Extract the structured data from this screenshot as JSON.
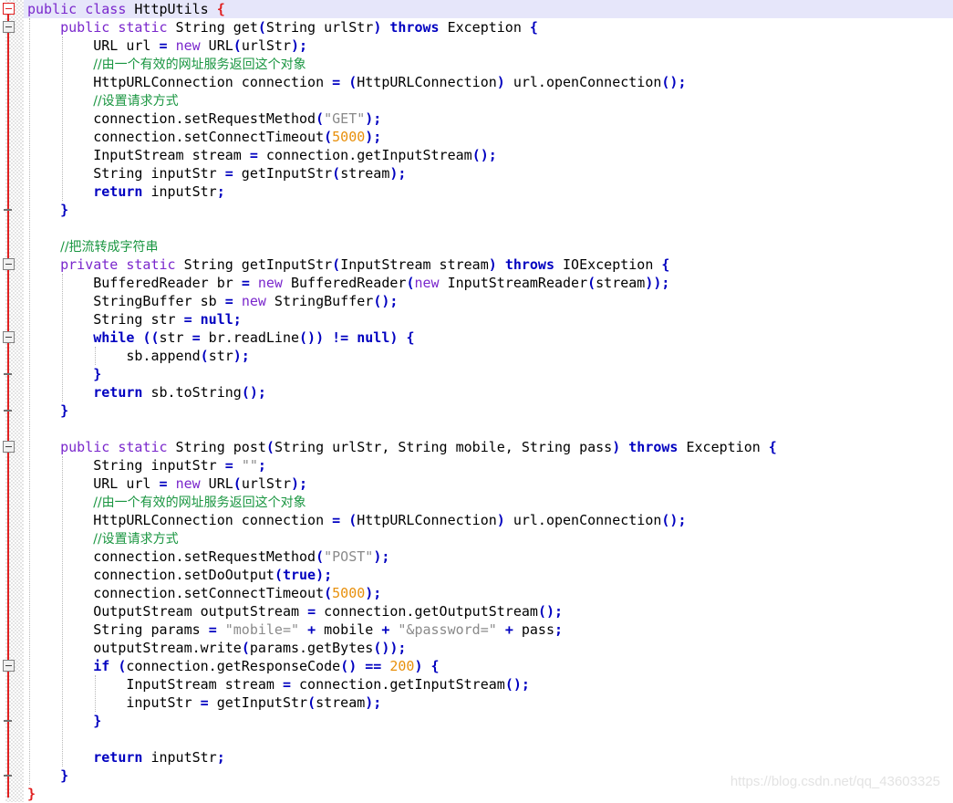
{
  "editor": {
    "language": "java",
    "class_name": "HttpUtils",
    "highlighted_line": 1,
    "colors": {
      "background": "#ffffff",
      "keyword": "#7a27cc",
      "keyword_bold": "#0000c0",
      "comment": "#1a9641",
      "string": "#8a8a8a",
      "number": "#e8900c",
      "punctuation": "#0000c0",
      "class_brace": "#e02020",
      "fold_line": "#e02020",
      "highlight_row": "#e6e6fa",
      "indent_guide": "#b8b8b8",
      "watermark": "#e3e3e3"
    }
  },
  "watermark": {
    "text": "https://blog.csdn.net/qq_43603325"
  },
  "gutter": {
    "fold_boxes_label": "collapse-block",
    "fold_tick_label": "block-end-marker"
  },
  "code_lines": [
    {
      "n": 1,
      "indent": 0,
      "highlight": true,
      "tokens": [
        {
          "t": "public",
          "c": "kw"
        },
        {
          "t": " ",
          "c": "id"
        },
        {
          "t": "class",
          "c": "kw"
        },
        {
          "t": " ",
          "c": "id"
        },
        {
          "t": "HttpUtils",
          "c": "id"
        },
        {
          "t": " ",
          "c": "id"
        },
        {
          "t": "{",
          "c": "brc"
        }
      ]
    },
    {
      "n": 2,
      "indent": 1,
      "tokens": [
        {
          "t": "public",
          "c": "kw"
        },
        {
          "t": " ",
          "c": "id"
        },
        {
          "t": "static",
          "c": "kw"
        },
        {
          "t": " String get",
          "c": "id"
        },
        {
          "t": "(",
          "c": "pun"
        },
        {
          "t": "String urlStr",
          "c": "id"
        },
        {
          "t": ")",
          "c": "pun"
        },
        {
          "t": " ",
          "c": "id"
        },
        {
          "t": "throws",
          "c": "kwb"
        },
        {
          "t": " Exception ",
          "c": "id"
        },
        {
          "t": "{",
          "c": "pun"
        }
      ]
    },
    {
      "n": 3,
      "indent": 2,
      "tokens": [
        {
          "t": "URL url ",
          "c": "id"
        },
        {
          "t": "=",
          "c": "pun"
        },
        {
          "t": " ",
          "c": "id"
        },
        {
          "t": "new",
          "c": "kw"
        },
        {
          "t": " URL",
          "c": "id"
        },
        {
          "t": "(",
          "c": "pun"
        },
        {
          "t": "urlStr",
          "c": "id"
        },
        {
          "t": ");",
          "c": "pun"
        }
      ]
    },
    {
      "n": 4,
      "indent": 2,
      "tokens": [
        {
          "t": "//由一个有效的网址服务返回这个对象",
          "c": "cmt cn"
        }
      ]
    },
    {
      "n": 5,
      "indent": 2,
      "tokens": [
        {
          "t": "HttpURLConnection connection ",
          "c": "id"
        },
        {
          "t": "=",
          "c": "pun"
        },
        {
          "t": " ",
          "c": "id"
        },
        {
          "t": "(",
          "c": "pun"
        },
        {
          "t": "HttpURLConnection",
          "c": "id"
        },
        {
          "t": ")",
          "c": "pun"
        },
        {
          "t": " url.openConnection",
          "c": "id"
        },
        {
          "t": "();",
          "c": "pun"
        }
      ]
    },
    {
      "n": 6,
      "indent": 2,
      "tokens": [
        {
          "t": "//设置请求方式",
          "c": "cmt cn"
        }
      ]
    },
    {
      "n": 7,
      "indent": 2,
      "tokens": [
        {
          "t": "connection.setRequestMethod",
          "c": "id"
        },
        {
          "t": "(",
          "c": "pun"
        },
        {
          "t": "\"GET\"",
          "c": "str"
        },
        {
          "t": ");",
          "c": "pun"
        }
      ]
    },
    {
      "n": 8,
      "indent": 2,
      "tokens": [
        {
          "t": "connection.setConnectTimeout",
          "c": "id"
        },
        {
          "t": "(",
          "c": "pun"
        },
        {
          "t": "5000",
          "c": "num"
        },
        {
          "t": ");",
          "c": "pun"
        }
      ]
    },
    {
      "n": 9,
      "indent": 2,
      "tokens": [
        {
          "t": "InputStream stream ",
          "c": "id"
        },
        {
          "t": "=",
          "c": "pun"
        },
        {
          "t": " connection.getInputStream",
          "c": "id"
        },
        {
          "t": "();",
          "c": "pun"
        }
      ]
    },
    {
      "n": 10,
      "indent": 2,
      "tokens": [
        {
          "t": "String inputStr ",
          "c": "id"
        },
        {
          "t": "=",
          "c": "pun"
        },
        {
          "t": " getInputStr",
          "c": "id"
        },
        {
          "t": "(",
          "c": "pun"
        },
        {
          "t": "stream",
          "c": "id"
        },
        {
          "t": ");",
          "c": "pun"
        }
      ]
    },
    {
      "n": 11,
      "indent": 2,
      "tokens": [
        {
          "t": "return",
          "c": "kwb"
        },
        {
          "t": " inputStr",
          "c": "id"
        },
        {
          "t": ";",
          "c": "pun"
        }
      ]
    },
    {
      "n": 12,
      "indent": 1,
      "tokens": [
        {
          "t": "}",
          "c": "pun"
        }
      ]
    },
    {
      "n": 13,
      "indent": 0,
      "tokens": []
    },
    {
      "n": 14,
      "indent": 1,
      "tokens": [
        {
          "t": "//把流转成字符串",
          "c": "cmt cn"
        }
      ]
    },
    {
      "n": 15,
      "indent": 1,
      "tokens": [
        {
          "t": "private",
          "c": "kw"
        },
        {
          "t": " ",
          "c": "id"
        },
        {
          "t": "static",
          "c": "kw"
        },
        {
          "t": " String getInputStr",
          "c": "id"
        },
        {
          "t": "(",
          "c": "pun"
        },
        {
          "t": "InputStream stream",
          "c": "id"
        },
        {
          "t": ")",
          "c": "pun"
        },
        {
          "t": " ",
          "c": "id"
        },
        {
          "t": "throws",
          "c": "kwb"
        },
        {
          "t": " IOException ",
          "c": "id"
        },
        {
          "t": "{",
          "c": "pun"
        }
      ]
    },
    {
      "n": 16,
      "indent": 2,
      "tokens": [
        {
          "t": "BufferedReader br ",
          "c": "id"
        },
        {
          "t": "=",
          "c": "pun"
        },
        {
          "t": " ",
          "c": "id"
        },
        {
          "t": "new",
          "c": "kw"
        },
        {
          "t": " BufferedReader",
          "c": "id"
        },
        {
          "t": "(",
          "c": "pun"
        },
        {
          "t": "new",
          "c": "kw"
        },
        {
          "t": " InputStreamReader",
          "c": "id"
        },
        {
          "t": "(",
          "c": "pun"
        },
        {
          "t": "stream",
          "c": "id"
        },
        {
          "t": "));",
          "c": "pun"
        }
      ]
    },
    {
      "n": 17,
      "indent": 2,
      "tokens": [
        {
          "t": "StringBuffer sb ",
          "c": "id"
        },
        {
          "t": "=",
          "c": "pun"
        },
        {
          "t": " ",
          "c": "id"
        },
        {
          "t": "new",
          "c": "kw"
        },
        {
          "t": " StringBuffer",
          "c": "id"
        },
        {
          "t": "();",
          "c": "pun"
        }
      ]
    },
    {
      "n": 18,
      "indent": 2,
      "tokens": [
        {
          "t": "String str ",
          "c": "id"
        },
        {
          "t": "=",
          "c": "pun"
        },
        {
          "t": " ",
          "c": "id"
        },
        {
          "t": "null",
          "c": "kwb"
        },
        {
          "t": ";",
          "c": "pun"
        }
      ]
    },
    {
      "n": 19,
      "indent": 2,
      "tokens": [
        {
          "t": "while",
          "c": "kwb"
        },
        {
          "t": " ",
          "c": "id"
        },
        {
          "t": "((",
          "c": "pun"
        },
        {
          "t": "str ",
          "c": "id"
        },
        {
          "t": "=",
          "c": "pun"
        },
        {
          "t": " br.readLine",
          "c": "id"
        },
        {
          "t": "())",
          "c": "pun"
        },
        {
          "t": " ",
          "c": "id"
        },
        {
          "t": "!=",
          "c": "pun"
        },
        {
          "t": " ",
          "c": "id"
        },
        {
          "t": "null",
          "c": "kwb"
        },
        {
          "t": ")",
          "c": "pun"
        },
        {
          "t": " ",
          "c": "id"
        },
        {
          "t": "{",
          "c": "pun"
        }
      ]
    },
    {
      "n": 20,
      "indent": 3,
      "tokens": [
        {
          "t": "sb.append",
          "c": "id"
        },
        {
          "t": "(",
          "c": "pun"
        },
        {
          "t": "str",
          "c": "id"
        },
        {
          "t": ");",
          "c": "pun"
        }
      ]
    },
    {
      "n": 21,
      "indent": 2,
      "tokens": [
        {
          "t": "}",
          "c": "pun"
        }
      ]
    },
    {
      "n": 22,
      "indent": 2,
      "tokens": [
        {
          "t": "return",
          "c": "kwb"
        },
        {
          "t": " sb.toString",
          "c": "id"
        },
        {
          "t": "();",
          "c": "pun"
        }
      ]
    },
    {
      "n": 23,
      "indent": 1,
      "tokens": [
        {
          "t": "}",
          "c": "pun"
        }
      ]
    },
    {
      "n": 24,
      "indent": 0,
      "tokens": []
    },
    {
      "n": 25,
      "indent": 1,
      "tokens": [
        {
          "t": "public",
          "c": "kw"
        },
        {
          "t": " ",
          "c": "id"
        },
        {
          "t": "static",
          "c": "kw"
        },
        {
          "t": " String post",
          "c": "id"
        },
        {
          "t": "(",
          "c": "pun"
        },
        {
          "t": "String urlStr, String mobile, String pass",
          "c": "id"
        },
        {
          "t": ")",
          "c": "pun"
        },
        {
          "t": " ",
          "c": "id"
        },
        {
          "t": "throws",
          "c": "kwb"
        },
        {
          "t": " Exception ",
          "c": "id"
        },
        {
          "t": "{",
          "c": "pun"
        }
      ]
    },
    {
      "n": 26,
      "indent": 2,
      "tokens": [
        {
          "t": "String inputStr ",
          "c": "id"
        },
        {
          "t": "=",
          "c": "pun"
        },
        {
          "t": " ",
          "c": "id"
        },
        {
          "t": "\"\"",
          "c": "str"
        },
        {
          "t": ";",
          "c": "pun"
        }
      ]
    },
    {
      "n": 27,
      "indent": 2,
      "tokens": [
        {
          "t": "URL url ",
          "c": "id"
        },
        {
          "t": "=",
          "c": "pun"
        },
        {
          "t": " ",
          "c": "id"
        },
        {
          "t": "new",
          "c": "kw"
        },
        {
          "t": " URL",
          "c": "id"
        },
        {
          "t": "(",
          "c": "pun"
        },
        {
          "t": "urlStr",
          "c": "id"
        },
        {
          "t": ");",
          "c": "pun"
        }
      ]
    },
    {
      "n": 28,
      "indent": 2,
      "tokens": [
        {
          "t": "//由一个有效的网址服务返回这个对象",
          "c": "cmt cn"
        }
      ]
    },
    {
      "n": 29,
      "indent": 2,
      "tokens": [
        {
          "t": "HttpURLConnection connection ",
          "c": "id"
        },
        {
          "t": "=",
          "c": "pun"
        },
        {
          "t": " ",
          "c": "id"
        },
        {
          "t": "(",
          "c": "pun"
        },
        {
          "t": "HttpURLConnection",
          "c": "id"
        },
        {
          "t": ")",
          "c": "pun"
        },
        {
          "t": " url.openConnection",
          "c": "id"
        },
        {
          "t": "();",
          "c": "pun"
        }
      ]
    },
    {
      "n": 30,
      "indent": 2,
      "tokens": [
        {
          "t": "//设置请求方式",
          "c": "cmt cn"
        }
      ]
    },
    {
      "n": 31,
      "indent": 2,
      "tokens": [
        {
          "t": "connection.setRequestMethod",
          "c": "id"
        },
        {
          "t": "(",
          "c": "pun"
        },
        {
          "t": "\"POST\"",
          "c": "str"
        },
        {
          "t": ");",
          "c": "pun"
        }
      ]
    },
    {
      "n": 32,
      "indent": 2,
      "tokens": [
        {
          "t": "connection.setDoOutput",
          "c": "id"
        },
        {
          "t": "(",
          "c": "pun"
        },
        {
          "t": "true",
          "c": "kwb"
        },
        {
          "t": ");",
          "c": "pun"
        }
      ]
    },
    {
      "n": 33,
      "indent": 2,
      "tokens": [
        {
          "t": "connection.setConnectTimeout",
          "c": "id"
        },
        {
          "t": "(",
          "c": "pun"
        },
        {
          "t": "5000",
          "c": "num"
        },
        {
          "t": ");",
          "c": "pun"
        }
      ]
    },
    {
      "n": 34,
      "indent": 2,
      "tokens": [
        {
          "t": "OutputStream outputStream ",
          "c": "id"
        },
        {
          "t": "=",
          "c": "pun"
        },
        {
          "t": " connection.getOutputStream",
          "c": "id"
        },
        {
          "t": "();",
          "c": "pun"
        }
      ]
    },
    {
      "n": 35,
      "indent": 2,
      "tokens": [
        {
          "t": "String params ",
          "c": "id"
        },
        {
          "t": "=",
          "c": "pun"
        },
        {
          "t": " ",
          "c": "id"
        },
        {
          "t": "\"mobile=\"",
          "c": "str"
        },
        {
          "t": " ",
          "c": "id"
        },
        {
          "t": "+",
          "c": "pun"
        },
        {
          "t": " mobile ",
          "c": "id"
        },
        {
          "t": "+",
          "c": "pun"
        },
        {
          "t": " ",
          "c": "id"
        },
        {
          "t": "\"&password=\"",
          "c": "str"
        },
        {
          "t": " ",
          "c": "id"
        },
        {
          "t": "+",
          "c": "pun"
        },
        {
          "t": " pass",
          "c": "id"
        },
        {
          "t": ";",
          "c": "pun"
        }
      ]
    },
    {
      "n": 36,
      "indent": 2,
      "tokens": [
        {
          "t": "outputStream.write",
          "c": "id"
        },
        {
          "t": "(",
          "c": "pun"
        },
        {
          "t": "params.getBytes",
          "c": "id"
        },
        {
          "t": "());",
          "c": "pun"
        }
      ]
    },
    {
      "n": 37,
      "indent": 2,
      "tokens": [
        {
          "t": "if",
          "c": "kwb"
        },
        {
          "t": " ",
          "c": "id"
        },
        {
          "t": "(",
          "c": "pun"
        },
        {
          "t": "connection.getResponseCode",
          "c": "id"
        },
        {
          "t": "()",
          "c": "pun"
        },
        {
          "t": " ",
          "c": "id"
        },
        {
          "t": "==",
          "c": "pun"
        },
        {
          "t": " ",
          "c": "id"
        },
        {
          "t": "200",
          "c": "num"
        },
        {
          "t": ")",
          "c": "pun"
        },
        {
          "t": " ",
          "c": "id"
        },
        {
          "t": "{",
          "c": "pun"
        }
      ]
    },
    {
      "n": 38,
      "indent": 3,
      "tokens": [
        {
          "t": "InputStream stream ",
          "c": "id"
        },
        {
          "t": "=",
          "c": "pun"
        },
        {
          "t": " connection.getInputStream",
          "c": "id"
        },
        {
          "t": "();",
          "c": "pun"
        }
      ]
    },
    {
      "n": 39,
      "indent": 3,
      "tokens": [
        {
          "t": "inputStr ",
          "c": "id"
        },
        {
          "t": "=",
          "c": "pun"
        },
        {
          "t": " getInputStr",
          "c": "id"
        },
        {
          "t": "(",
          "c": "pun"
        },
        {
          "t": "stream",
          "c": "id"
        },
        {
          "t": ");",
          "c": "pun"
        }
      ]
    },
    {
      "n": 40,
      "indent": 2,
      "tokens": [
        {
          "t": "}",
          "c": "pun"
        }
      ]
    },
    {
      "n": 41,
      "indent": 0,
      "tokens": []
    },
    {
      "n": 42,
      "indent": 2,
      "tokens": [
        {
          "t": "return",
          "c": "kwb"
        },
        {
          "t": " inputStr",
          "c": "id"
        },
        {
          "t": ";",
          "c": "pun"
        }
      ]
    },
    {
      "n": 43,
      "indent": 1,
      "tokens": [
        {
          "t": "}",
          "c": "pun"
        }
      ]
    },
    {
      "n": 44,
      "indent": 0,
      "tokens": [
        {
          "t": "}",
          "c": "brc"
        }
      ]
    }
  ],
  "fold_markers": {
    "boxes": [
      {
        "line": 1,
        "root": true
      },
      {
        "line": 2,
        "root": false
      },
      {
        "line": 15,
        "root": false
      },
      {
        "line": 19,
        "root": false
      },
      {
        "line": 25,
        "root": false
      },
      {
        "line": 37,
        "root": false
      }
    ],
    "ticks": [
      12,
      21,
      23,
      40,
      43
    ]
  },
  "indent_guides": [
    {
      "level": 1,
      "from_line": 2,
      "to_line": 43
    },
    {
      "level": 2,
      "from_line": 3,
      "to_line": 11
    },
    {
      "level": 2,
      "from_line": 16,
      "to_line": 22
    },
    {
      "level": 3,
      "from_line": 20,
      "to_line": 20
    },
    {
      "level": 2,
      "from_line": 26,
      "to_line": 42
    },
    {
      "level": 3,
      "from_line": 38,
      "to_line": 39
    }
  ]
}
